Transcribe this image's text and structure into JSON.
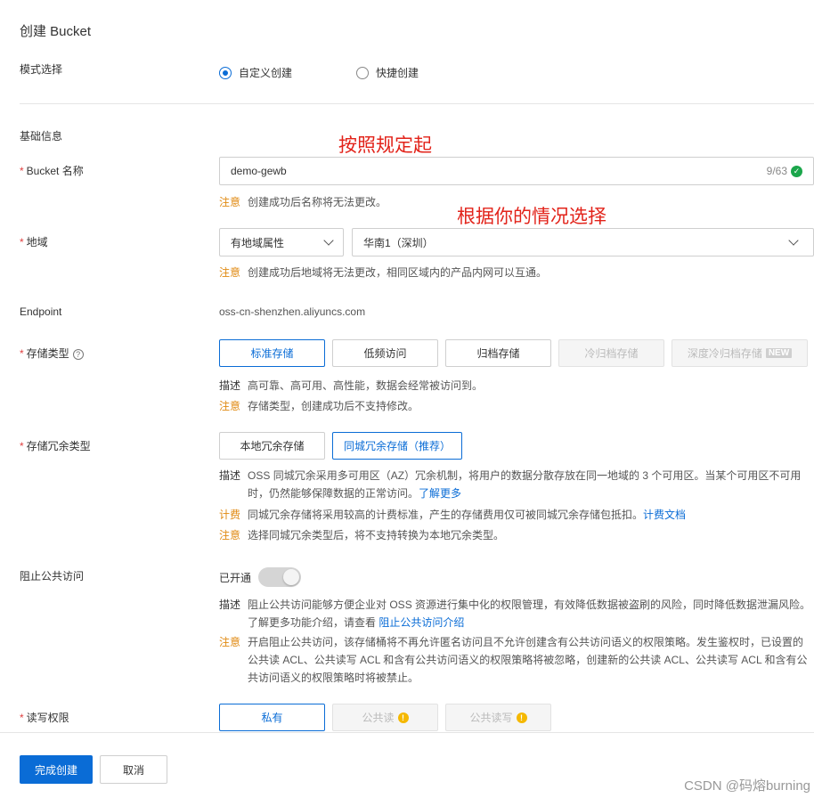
{
  "page": {
    "title": "创建 Bucket"
  },
  "mode": {
    "label": "模式选择",
    "options": [
      "自定义创建",
      "快捷创建"
    ],
    "selected": "自定义创建"
  },
  "basic": {
    "section": "基础信息"
  },
  "bucket_name": {
    "label": "Bucket 名称",
    "value": "demo-gewb",
    "counter": "9/63",
    "note_key": "注意",
    "note": "创建成功后名称将无法更改。"
  },
  "annotations": {
    "naming": "按照规定起",
    "choose": "根据你的情况选择"
  },
  "region": {
    "label": "地域",
    "attr_select": "有地域属性",
    "region_select": "华南1（深圳）",
    "note_key": "注意",
    "note": "创建成功后地域将无法更改，相同区域内的产品内网可以互通。"
  },
  "endpoint": {
    "label": "Endpoint",
    "value": "oss-cn-shenzhen.aliyuncs.com"
  },
  "storage_class": {
    "label": "存储类型",
    "options": [
      {
        "label": "标准存储",
        "state": "selected"
      },
      {
        "label": "低频访问",
        "state": "normal"
      },
      {
        "label": "归档存储",
        "state": "normal"
      },
      {
        "label": "冷归档存储",
        "state": "disabled"
      },
      {
        "label": "深度冷归档存储",
        "state": "disabled",
        "tag": "NEW"
      }
    ],
    "desc_key": "描述",
    "desc": "高可靠、高可用、高性能，数据会经常被访问到。",
    "note_key": "注意",
    "note": "存储类型，创建成功后不支持修改。"
  },
  "redundancy": {
    "label": "存储冗余类型",
    "options": [
      {
        "label": "本地冗余存储",
        "state": "normal"
      },
      {
        "label": "同城冗余存储（推荐）",
        "state": "selected"
      }
    ],
    "desc_key": "描述",
    "desc": "OSS 同城冗余采用多可用区（AZ）冗余机制，将用户的数据分散存放在同一地域的 3 个可用区。当某个可用区不可用时，仍然能够保障数据的正常访问。",
    "desc_link": "了解更多",
    "fee_key": "计费",
    "fee": "同城冗余存储将采用较高的计费标准，产生的存储费用仅可被同城冗余存储包抵扣。",
    "fee_link": "计费文档",
    "note_key": "注意",
    "note": "选择同城冗余类型后，将不支持转换为本地冗余类型。"
  },
  "block_public": {
    "label": "阻止公共访问",
    "status": "已开通",
    "enabled": true,
    "desc_key": "描述",
    "desc": "阻止公共访问能够方便企业对 OSS 资源进行集中化的权限管理，有效降低数据被盗刷的风险，同时降低数据泄漏风险。了解更多功能介绍，请查看",
    "desc_link": "阻止公共访问介绍",
    "note_key": "注意",
    "note": "开启阻止公共访问，该存储桶将不再允许匿名访问且不允许创建含有公共访问语义的权限策略。发生鉴权时，已设置的公共读 ACL、公共读写 ACL 和含有公共访问语义的权限策略将被忽略，创建新的公共读 ACL、公共读写 ACL 和含有公共访问语义的权限策略时将被禁止。"
  },
  "acl": {
    "label": "读写权限",
    "options": [
      {
        "label": "私有",
        "state": "selected"
      },
      {
        "label": "公共读",
        "state": "disabled"
      },
      {
        "label": "公共读写",
        "state": "disabled"
      }
    ]
  },
  "footer": {
    "confirm": "完成创建",
    "cancel": "取消"
  },
  "watermark": "CSDN @码熔burning",
  "colors": {
    "primary": "#0a6cd6",
    "warn": "#e08a12",
    "annotation": "#e2231a",
    "success": "#1ba64b"
  }
}
